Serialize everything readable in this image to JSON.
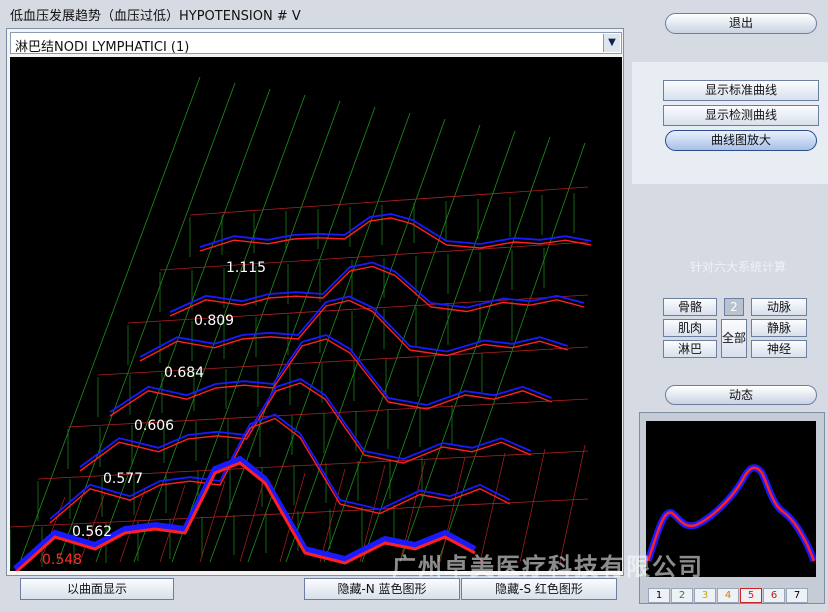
{
  "window_title": "低血压发展趋势（血压过低）HYPOTENSION # V",
  "dropdown": {
    "selected": "淋巴结NODI  LYMPHATICI  (1)"
  },
  "plot": {
    "value_labels": [
      "1.115",
      "0.809",
      "0.684",
      "0.606",
      "0.577",
      "0.562"
    ],
    "bottom_value": "0.548"
  },
  "bottom_buttons": {
    "surface": "以曲面显示",
    "hide_blue": "隐藏-N 蓝色图形",
    "hide_red": "隐藏-S 红色图形"
  },
  "right": {
    "exit": "退出",
    "show_standard": "显示标准曲线",
    "show_detected": "显示检测曲线",
    "zoom": "曲线图放大",
    "six_systems": "针对六大系统计算",
    "systems": {
      "bone": "骨骼",
      "badge": "2",
      "artery": "动脉",
      "muscle": "肌肉",
      "all": "全部",
      "vein": "静脉",
      "lymph": "淋巴",
      "nerve": "神经"
    },
    "dynamic": "动态",
    "tabs": [
      "1",
      "2",
      "3",
      "4",
      "5",
      "6",
      "7"
    ]
  },
  "watermark": "广州卓美医疗科技有限公司",
  "colors": {
    "blue_curve": "#1a1aff",
    "red_curve": "#ff2020",
    "grid_green": "#1f8f1f",
    "grid_red": "#b02020"
  }
}
